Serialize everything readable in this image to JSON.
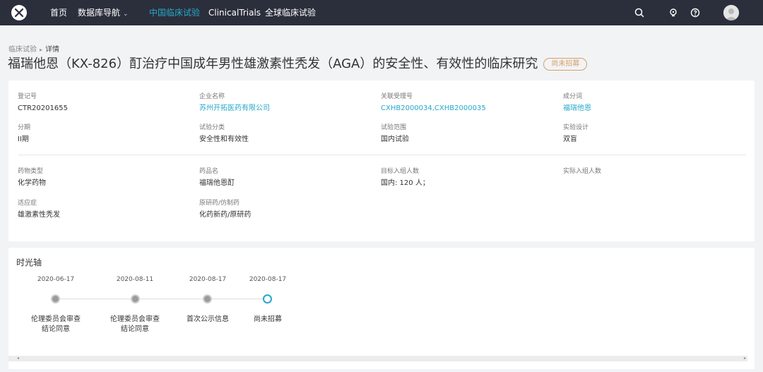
{
  "nav": {
    "items": [
      "首页",
      "数据库导航",
      "中国临床试验",
      "ClinicalTrials",
      "全球临床试验"
    ],
    "active_index": 2,
    "dropdown_chevron": "⌄"
  },
  "breadcrumb": {
    "parent": "临床试验",
    "separator": "▸",
    "current": "详情"
  },
  "trial": {
    "title": "福瑞他恩（KX-826）酊治疗中国成年男性雄激素性秃发（AGA）的安全性、有效性的临床研究",
    "status_badge": "尚未招募"
  },
  "fields": [
    {
      "label": "登记号",
      "value": "CTR20201655",
      "link": false
    },
    {
      "label": "企业名称",
      "value": "苏州开拓医药有限公司",
      "link": true
    },
    {
      "label": "关联受理号",
      "value": "CXHB2000034,CXHB2000035",
      "link": true
    },
    {
      "label": "成分词",
      "value": "福瑞他恩",
      "link": true
    },
    {
      "label": "分期",
      "value": "II期",
      "link": false
    },
    {
      "label": "试验分类",
      "value": "安全性和有效性",
      "link": false
    },
    {
      "label": "试验范围",
      "value": "国内试验",
      "link": false
    },
    {
      "label": "实验设计",
      "value": "双盲",
      "link": false
    },
    {
      "label": "药物类型",
      "value": "化学药物",
      "link": false
    },
    {
      "label": "药品名",
      "value": "福瑞他恩酊",
      "link": false
    },
    {
      "label": "目标入组人数",
      "value": "国内: 120 人；",
      "link": false
    },
    {
      "label": "实际入组人数",
      "value": "",
      "link": false
    },
    {
      "label": "适应症",
      "value": "雄激素性秃发",
      "link": false
    },
    {
      "label": "原研药/仿制药",
      "value": "化药新药/原研药",
      "link": false
    }
  ],
  "timeline": {
    "title": "时光轴",
    "events": [
      {
        "date": "2020-06-17",
        "label": "伦理委员会审查\n结论同意",
        "current": false
      },
      {
        "date": "2020-08-11",
        "label": "伦理委员会审查\n结论同意",
        "current": false
      },
      {
        "date": "2020-08-17",
        "label": "首次公示信息",
        "current": false
      },
      {
        "date": "2020-08-17",
        "label": "尚未招募",
        "current": true
      }
    ]
  },
  "colors": {
    "accent": "#27a8c9",
    "topbar": "#2b2f3c",
    "badge": "#d4a26b"
  },
  "icons": [
    "logo-icon",
    "search-icon",
    "lightbulb-icon",
    "help-icon",
    "user-avatar-icon"
  ]
}
